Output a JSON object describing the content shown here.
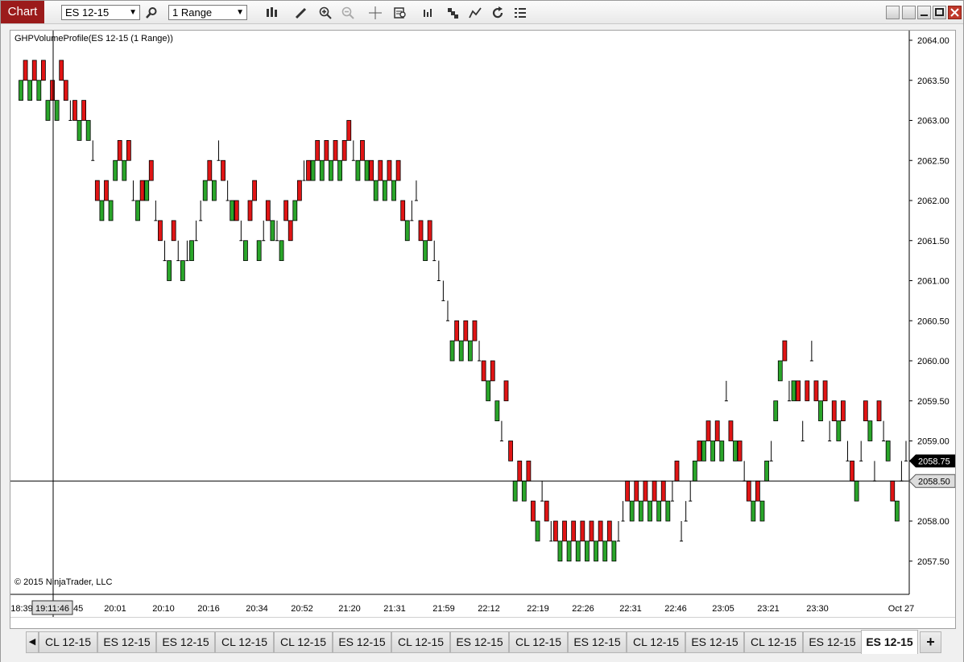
{
  "toolbar": {
    "chart_tab_label": "Chart",
    "instrument_value": "ES 12-15",
    "period_value": "1 Range",
    "icons": [
      "search-icon",
      "bar-type-icon",
      "draw-pencil-icon",
      "zoom-in-icon",
      "zoom-out-icon",
      "crosshair-icon",
      "data-box-icon",
      "indicators-icon",
      "strategies-icon",
      "drawing-tools-icon",
      "reload-icon",
      "properties-icon"
    ]
  },
  "chart": {
    "indicator_label": "GHPVolumeProfile(ES 12-15 (1 Range))",
    "copyright": "© 2015 NinjaTrader, LLC",
    "crosshair_time_label": "19:11:46",
    "crosshair_price_label": "2058.50",
    "last_price_label": "2058.75",
    "colors": {
      "up": "#2aa52a",
      "down": "#e01515",
      "grid": "#e6e6e6",
      "text": "#000000",
      "last_price_bg": "#000000"
    }
  },
  "chart_data": {
    "type": "bar",
    "chart_style": "renko-like range bars (up = green, down = red, flat = tick)",
    "y_axis_ticks": [
      "2064.00",
      "2063.50",
      "2063.00",
      "2062.50",
      "2062.00",
      "2061.50",
      "2061.00",
      "2060.50",
      "2060.00",
      "2059.50",
      "2059.00",
      "2058.50",
      "2058.00",
      "2057.50"
    ],
    "ylim": [
      2057.25,
      2064.0
    ],
    "x_axis_labels": [
      "18:39",
      "19:11:46",
      "20:01",
      "20:10",
      "20:16",
      "20:34",
      "20:52",
      "21:20",
      "21:31",
      "21:59",
      "22:12",
      "22:19",
      "22:26",
      "22:31",
      "22:46",
      "23:05",
      "23:21",
      "23:30",
      "Oct 27"
    ],
    "x_axis_label_tail": "45",
    "bars": [
      [
        "u",
        2063.25,
        2063.5
      ],
      [
        "d",
        2063.5,
        2063.75
      ],
      [
        "u",
        2063.25,
        2063.5
      ],
      [
        "d",
        2063.5,
        2063.75
      ],
      [
        "u",
        2063.25,
        2063.5
      ],
      [
        "d",
        2063.5,
        2063.75
      ],
      [
        "u",
        2063.0,
        2063.25
      ],
      [
        "d",
        2063.25,
        2063.5
      ],
      [
        "u",
        2063.0,
        2063.25
      ],
      [
        "d",
        2063.5,
        2063.75
      ],
      [
        "d",
        2063.25,
        2063.5
      ],
      [
        "t",
        2063.0,
        2063.25
      ],
      [
        "d",
        2063.0,
        2063.25
      ],
      [
        "u",
        2062.75,
        2063.0
      ],
      [
        "d",
        2063.0,
        2063.25
      ],
      [
        "u",
        2062.75,
        2063.0
      ],
      [
        "t",
        2062.5,
        2062.75
      ],
      [
        "d",
        2062.0,
        2062.25
      ],
      [
        "u",
        2061.75,
        2062.0
      ],
      [
        "d",
        2062.0,
        2062.25
      ],
      [
        "u",
        2061.75,
        2062.0
      ],
      [
        "u",
        2062.25,
        2062.5
      ],
      [
        "d",
        2062.5,
        2062.75
      ],
      [
        "u",
        2062.25,
        2062.5
      ],
      [
        "d",
        2062.5,
        2062.75
      ],
      [
        "t",
        2062.0,
        2062.25
      ],
      [
        "u",
        2061.75,
        2062.0
      ],
      [
        "d",
        2062.0,
        2062.25
      ],
      [
        "u",
        2062.0,
        2062.25
      ],
      [
        "d",
        2062.25,
        2062.5
      ],
      [
        "t",
        2061.75,
        2062.0
      ],
      [
        "d",
        2061.5,
        2061.75
      ],
      [
        "t",
        2061.25,
        2061.5
      ],
      [
        "u",
        2061.0,
        2061.25
      ],
      [
        "d",
        2061.5,
        2061.75
      ],
      [
        "t",
        2061.25,
        2061.5
      ],
      [
        "u",
        2061.0,
        2061.25
      ],
      [
        "t",
        2061.25,
        2061.5
      ],
      [
        "u",
        2061.25,
        2061.5
      ],
      [
        "t",
        2061.5,
        2061.75
      ],
      [
        "t",
        2061.75,
        2062.0
      ],
      [
        "u",
        2062.0,
        2062.25
      ],
      [
        "d",
        2062.25,
        2062.5
      ],
      [
        "u",
        2062.0,
        2062.25
      ],
      [
        "t",
        2062.5,
        2062.75
      ],
      [
        "d",
        2062.25,
        2062.5
      ],
      [
        "t",
        2062.0,
        2062.25
      ],
      [
        "u",
        2061.75,
        2062.0
      ],
      [
        "d",
        2061.75,
        2062.0
      ],
      [
        "t",
        2061.5,
        2061.75
      ],
      [
        "u",
        2061.25,
        2061.5
      ],
      [
        "d",
        2061.75,
        2062.0
      ],
      [
        "d",
        2062.0,
        2062.25
      ],
      [
        "u",
        2061.25,
        2061.5
      ],
      [
        "t",
        2061.5,
        2061.75
      ],
      [
        "d",
        2061.75,
        2062.0
      ],
      [
        "u",
        2061.5,
        2061.75
      ],
      [
        "t",
        2061.5,
        2061.75
      ],
      [
        "u",
        2061.25,
        2061.5
      ],
      [
        "d",
        2061.75,
        2062.0
      ],
      [
        "d",
        2061.5,
        2061.75
      ],
      [
        "u",
        2061.75,
        2062.0
      ],
      [
        "d",
        2062.0,
        2062.25
      ],
      [
        "t",
        2062.25,
        2062.5
      ],
      [
        "d",
        2062.25,
        2062.5
      ],
      [
        "u",
        2062.25,
        2062.5
      ],
      [
        "d",
        2062.5,
        2062.75
      ],
      [
        "u",
        2062.25,
        2062.5
      ],
      [
        "d",
        2062.5,
        2062.75
      ],
      [
        "u",
        2062.25,
        2062.5
      ],
      [
        "d",
        2062.5,
        2062.75
      ],
      [
        "u",
        2062.25,
        2062.5
      ],
      [
        "d",
        2062.5,
        2062.75
      ],
      [
        "d",
        2062.75,
        2063.0
      ],
      [
        "t",
        2062.5,
        2062.75
      ],
      [
        "u",
        2062.25,
        2062.5
      ],
      [
        "d",
        2062.5,
        2062.75
      ],
      [
        "u",
        2062.25,
        2062.5
      ],
      [
        "d",
        2062.25,
        2062.5
      ],
      [
        "u",
        2062.0,
        2062.25
      ],
      [
        "d",
        2062.25,
        2062.5
      ],
      [
        "u",
        2062.0,
        2062.25
      ],
      [
        "d",
        2062.25,
        2062.5
      ],
      [
        "u",
        2062.0,
        2062.25
      ],
      [
        "d",
        2062.25,
        2062.5
      ],
      [
        "d",
        2061.75,
        2062.0
      ],
      [
        "u",
        2061.5,
        2061.75
      ],
      [
        "t",
        2061.75,
        2062.0
      ],
      [
        "t",
        2062.0,
        2062.25
      ],
      [
        "d",
        2061.5,
        2061.75
      ],
      [
        "u",
        2061.25,
        2061.5
      ],
      [
        "d",
        2061.5,
        2061.75
      ],
      [
        "t",
        2061.25,
        2061.5
      ],
      [
        "t",
        2061.0,
        2061.25
      ],
      [
        "t",
        2060.75,
        2061.0
      ],
      [
        "t",
        2060.5,
        2060.75
      ],
      [
        "u",
        2060.0,
        2060.25
      ],
      [
        "d",
        2060.25,
        2060.5
      ],
      [
        "u",
        2060.0,
        2060.25
      ],
      [
        "d",
        2060.25,
        2060.5
      ],
      [
        "u",
        2060.0,
        2060.25
      ],
      [
        "d",
        2060.25,
        2060.5
      ],
      [
        "t",
        2060.0,
        2060.25
      ],
      [
        "d",
        2059.75,
        2060.0
      ],
      [
        "u",
        2059.5,
        2059.75
      ],
      [
        "d",
        2059.75,
        2060.0
      ],
      [
        "u",
        2059.25,
        2059.5
      ],
      [
        "t",
        2059.0,
        2059.25
      ],
      [
        "d",
        2059.5,
        2059.75
      ],
      [
        "d",
        2058.75,
        2059.0
      ],
      [
        "u",
        2058.25,
        2058.5
      ],
      [
        "d",
        2058.5,
        2058.75
      ],
      [
        "u",
        2058.25,
        2058.5
      ],
      [
        "d",
        2058.5,
        2058.75
      ],
      [
        "d",
        2058.0,
        2058.25
      ],
      [
        "u",
        2057.75,
        2058.0
      ],
      [
        "t",
        2058.25,
        2058.5
      ],
      [
        "d",
        2058.0,
        2058.25
      ],
      [
        "t",
        2057.75,
        2058.0
      ],
      [
        "d",
        2057.75,
        2058.0
      ],
      [
        "u",
        2057.5,
        2057.75
      ],
      [
        "d",
        2057.75,
        2058.0
      ],
      [
        "u",
        2057.5,
        2057.75
      ],
      [
        "d",
        2057.75,
        2058.0
      ],
      [
        "u",
        2057.5,
        2057.75
      ],
      [
        "d",
        2057.75,
        2058.0
      ],
      [
        "u",
        2057.5,
        2057.75
      ],
      [
        "d",
        2057.75,
        2058.0
      ],
      [
        "u",
        2057.5,
        2057.75
      ],
      [
        "d",
        2057.75,
        2058.0
      ],
      [
        "u",
        2057.5,
        2057.75
      ],
      [
        "d",
        2057.75,
        2058.0
      ],
      [
        "u",
        2057.5,
        2057.75
      ],
      [
        "t",
        2057.75,
        2058.0
      ],
      [
        "t",
        2058.0,
        2058.25
      ],
      [
        "d",
        2058.25,
        2058.5
      ],
      [
        "u",
        2058.0,
        2058.25
      ],
      [
        "d",
        2058.25,
        2058.5
      ],
      [
        "u",
        2058.0,
        2058.25
      ],
      [
        "d",
        2058.25,
        2058.5
      ],
      [
        "u",
        2058.0,
        2058.25
      ],
      [
        "d",
        2058.25,
        2058.5
      ],
      [
        "u",
        2058.0,
        2058.25
      ],
      [
        "d",
        2058.25,
        2058.5
      ],
      [
        "u",
        2058.0,
        2058.25
      ],
      [
        "t",
        2058.25,
        2058.5
      ],
      [
        "d",
        2058.5,
        2058.75
      ],
      [
        "t",
        2057.75,
        2058.0
      ],
      [
        "t",
        2058.0,
        2058.25
      ],
      [
        "t",
        2058.25,
        2058.5
      ],
      [
        "u",
        2058.5,
        2058.75
      ],
      [
        "d",
        2058.75,
        2059.0
      ],
      [
        "u",
        2058.75,
        2059.0
      ],
      [
        "d",
        2059.0,
        2059.25
      ],
      [
        "u",
        2058.75,
        2059.0
      ],
      [
        "d",
        2059.0,
        2059.25
      ],
      [
        "u",
        2058.75,
        2059.0
      ],
      [
        "t",
        2059.5,
        2059.75
      ],
      [
        "d",
        2059.0,
        2059.25
      ],
      [
        "u",
        2058.75,
        2059.0
      ],
      [
        "d",
        2058.75,
        2059.0
      ],
      [
        "t",
        2058.5,
        2058.75
      ],
      [
        "d",
        2058.25,
        2058.5
      ],
      [
        "u",
        2058.0,
        2058.25
      ],
      [
        "d",
        2058.25,
        2058.5
      ],
      [
        "u",
        2058.0,
        2058.25
      ],
      [
        "u",
        2058.5,
        2058.75
      ],
      [
        "t",
        2058.75,
        2059.0
      ],
      [
        "u",
        2059.25,
        2059.5
      ],
      [
        "u",
        2059.75,
        2060.0
      ],
      [
        "d",
        2060.0,
        2060.25
      ],
      [
        "t",
        2059.5,
        2059.75
      ],
      [
        "u",
        2059.5,
        2059.75
      ],
      [
        "d",
        2059.5,
        2059.75
      ],
      [
        "t",
        2059.0,
        2059.25
      ],
      [
        "d",
        2059.5,
        2059.75
      ],
      [
        "t",
        2060.0,
        2060.25
      ],
      [
        "d",
        2059.5,
        2059.75
      ],
      [
        "u",
        2059.25,
        2059.5
      ],
      [
        "d",
        2059.5,
        2059.75
      ],
      [
        "t",
        2059.0,
        2059.25
      ],
      [
        "d",
        2059.25,
        2059.5
      ],
      [
        "u",
        2059.0,
        2059.25
      ],
      [
        "d",
        2059.25,
        2059.5
      ],
      [
        "t",
        2058.75,
        2059.0
      ],
      [
        "d",
        2058.5,
        2058.75
      ],
      [
        "u",
        2058.25,
        2058.5
      ],
      [
        "t",
        2058.75,
        2059.0
      ],
      [
        "d",
        2059.25,
        2059.5
      ],
      [
        "u",
        2059.0,
        2059.25
      ],
      [
        "t",
        2058.5,
        2058.75
      ],
      [
        "d",
        2059.25,
        2059.5
      ],
      [
        "t",
        2059.0,
        2059.25
      ],
      [
        "u",
        2058.75,
        2059.0
      ],
      [
        "d",
        2058.25,
        2058.5
      ],
      [
        "u",
        2058.0,
        2058.25
      ],
      [
        "t",
        2058.5,
        2058.75
      ],
      [
        "t",
        2058.75,
        2059.0
      ]
    ]
  },
  "tabs": [
    {
      "label": "CL 12-15"
    },
    {
      "label": "ES 12-15"
    },
    {
      "label": "ES 12-15"
    },
    {
      "label": "CL 12-15"
    },
    {
      "label": "CL 12-15"
    },
    {
      "label": "ES 12-15"
    },
    {
      "label": "CL 12-15"
    },
    {
      "label": "ES 12-15"
    },
    {
      "label": "CL 12-15"
    },
    {
      "label": "ES 12-15"
    },
    {
      "label": "CL 12-15"
    },
    {
      "label": "ES 12-15"
    },
    {
      "label": "CL 12-15"
    },
    {
      "label": "ES 12-15"
    },
    {
      "label": "ES 12-15",
      "active": true
    }
  ],
  "tab_nav": {
    "prev": "◀",
    "add": "+"
  }
}
